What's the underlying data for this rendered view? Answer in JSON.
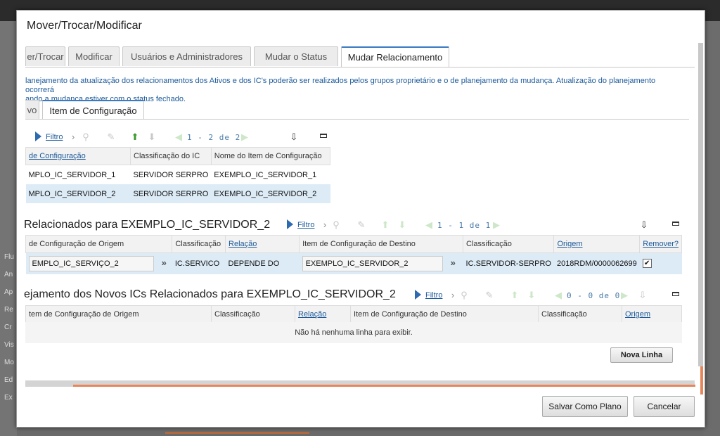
{
  "modal": {
    "title": "Mover/Trocar/Modificar",
    "tabs": [
      "er/Trocar",
      "Modificar",
      "Usuários e Administradores",
      "Mudar o Status",
      "Mudar Relacionamento"
    ],
    "info": "lanejamento da atualização dos relacionamentos dos Ativos e dos IC's poderão ser realizados pelos grupos proprietário e o de planejamento da mudança. Atualização do planejamento ocorrerá\nando a mudança estiver com o status fechado.",
    "subtabs": [
      "vo",
      "Item de Configuração"
    ]
  },
  "grid1": {
    "filter": "Filtro",
    "pager": "1 - 2 de 2",
    "headers": [
      "de Configuração",
      "Classificação do IC",
      "Nome do Item de Configuração"
    ],
    "rows": [
      [
        "MPLO_IC_SERVIDOR_1",
        "SERVIDOR SERPRO",
        "EXEMPLO_IC_SERVIDOR_1"
      ],
      [
        "MPLO_IC_SERVIDOR_2",
        "SERVIDOR SERPRO",
        "EXEMPLO_IC_SERVIDOR_2"
      ]
    ]
  },
  "grid2": {
    "title": "Relacionados para EXEMPLO_IC_SERVIDOR_2",
    "filter": "Filtro",
    "pager": "1 - 1 de 1",
    "headers": [
      "de Configuração de Origem",
      "Classificação",
      "Relação",
      "Item de Configuração de Destino",
      "Classificação",
      "Origem",
      "Remover?"
    ],
    "row": {
      "origem_ic": "EMPLO_IC_SERVIÇO_2",
      "classificacao": "IC.SERVICO",
      "relacao": "DEPENDE DO",
      "destino_ic": "EXEMPLO_IC_SERVIDOR_2",
      "classificacao_destino": "IC.SERVIDOR-SERPRO",
      "origem": "2018RDM/0000062699",
      "remover": "✔"
    }
  },
  "grid3": {
    "title": "ejamento dos Novos ICs Relacionados para EXEMPLO_IC_SERVIDOR_2",
    "filter": "Filtro",
    "pager": "0 - 0 de 0",
    "headers": [
      "tem de Configuração de Origem",
      "Classificação",
      "Relação",
      "Item de Configuração de Destino",
      "Classificação",
      "Origem"
    ],
    "empty": "Não há nenhuma linha para exibir."
  },
  "buttons": {
    "nova_linha": "Nova Linha",
    "salvar": "Salvar Como Plano",
    "cancelar": "Cancelar"
  },
  "background": {
    "left_items": [
      "Flu",
      "An",
      "Ap",
      "Re",
      "Cr",
      "Vis",
      "Mo",
      "Ed",
      "Ex"
    ]
  }
}
